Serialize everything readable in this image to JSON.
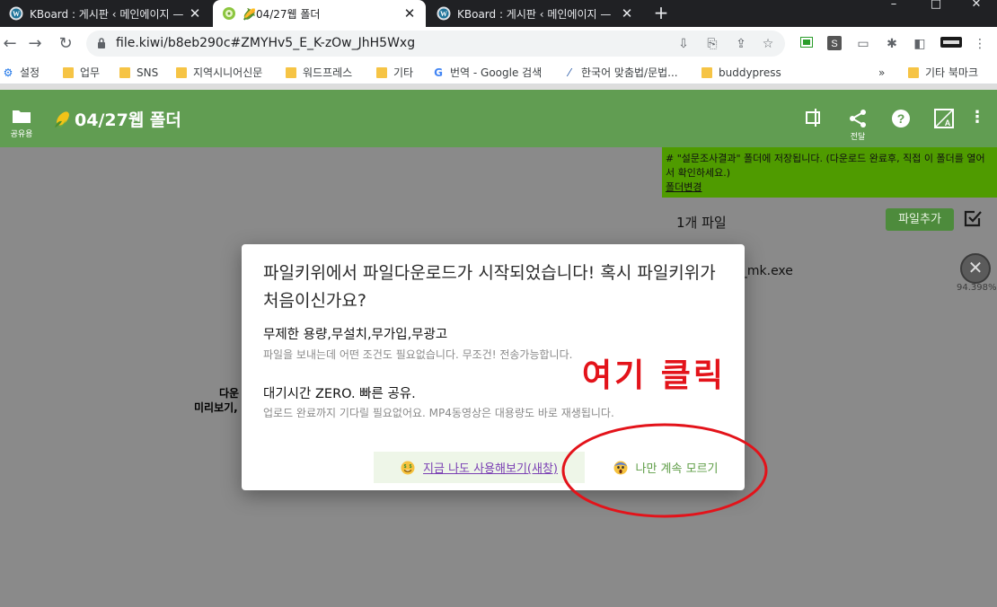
{
  "browser": {
    "tabs": [
      {
        "title": "KBoard : 게시판 ‹ 메인에이지 —",
        "icon": "wordpress-icon"
      },
      {
        "title": "🌽04/27웹 폴더",
        "icon": "filekiwi-icon"
      },
      {
        "title": "KBoard : 게시판 ‹ 메인에이지 —",
        "icon": "wordpress-icon"
      }
    ],
    "new_tab": "+",
    "url": "file.kiwi/b8eb290c#ZMYHv5_E_K-zOw_JhH5Wxg",
    "bookmarks": [
      {
        "label": "설정",
        "icon": "gear-icon"
      },
      {
        "label": "업무",
        "icon": "folder-icon"
      },
      {
        "label": "SNS",
        "icon": "folder-icon"
      },
      {
        "label": "지역시니어신문",
        "icon": "folder-icon"
      },
      {
        "label": "워드프레스",
        "icon": "folder-icon"
      },
      {
        "label": "기타",
        "icon": "folder-icon"
      },
      {
        "label": "번역 - Google 검색",
        "icon": "google-icon"
      },
      {
        "label": "한국어 맞춤법/문법...",
        "icon": "spell-icon"
      },
      {
        "label": "buddypress",
        "icon": "folder-icon"
      },
      {
        "label": "»",
        "icon": ""
      },
      {
        "label": "기타 북마크",
        "icon": "folder-icon"
      }
    ]
  },
  "app": {
    "share_label": "공유용",
    "title": "04/27웹 폴더",
    "share_caption": "전달",
    "colors": {
      "header": "#619d52",
      "notice": "#4f9b00",
      "accent": "#4d8b3c"
    }
  },
  "panel": {
    "notice": "# \"설문조사결과\" 폴더에 저장됩니다. (다운로드 완료후, 직접 이 폴더를 열어서 확인하세요.)",
    "change_folder": "폴더변경",
    "file_count": "1개 파일",
    "add_file": "파일추가",
    "file_name": "n_mk.exe",
    "progress": "94.398%"
  },
  "background_text": {
    "line1": "다운",
    "line2": "미리보기,"
  },
  "modal": {
    "title": "파일키위에서 파일다운로드가 시작되었습니다! 혹시 파일키위가 처음이신가요?",
    "feature1_title": "무제한 용량,무설치,무가입,무광고",
    "feature1_desc": "파일을 보내는데 어떤 조건도 필요없습니다. 무조건! 전송가능합니다.",
    "feature2_title": "대기시간 ZERO. 빠른 공유.",
    "feature2_desc": "업로드 완료까지 기다릴 필요없어요. MP4동영상은 대용량도 바로 재생됩니다.",
    "try_button": "지금 나도 사용해보기(새창)",
    "dismiss_button": "나만 계속 모르기"
  },
  "annotation": {
    "text": "여기 클릭",
    "color": "#e3131a"
  }
}
